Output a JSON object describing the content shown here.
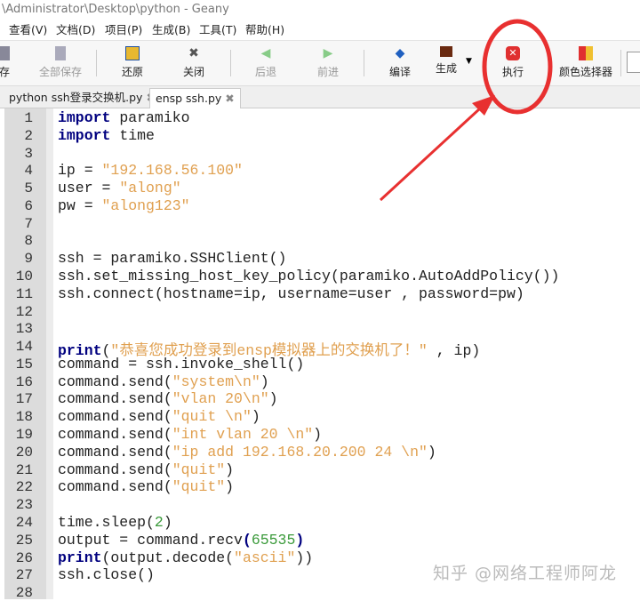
{
  "window": {
    "title": "\\Administrator\\Desktop\\python - Geany"
  },
  "menu": [
    "查看(V)",
    "文档(D)",
    "项目(P)",
    "生成(B)",
    "工具(T)",
    "帮助(H)"
  ],
  "toolbar": {
    "save": "存",
    "save_all": "全部保存",
    "revert": "还原",
    "close": "关闭",
    "back": "后退",
    "forward": "前进",
    "compile": "编译",
    "build": "生成",
    "execute": "执行",
    "color_picker": "颜色选择器"
  },
  "tabs": [
    {
      "label": "python ssh登录交换机.py",
      "close": "✖"
    },
    {
      "label": "ensp ssh.py",
      "close": "✖"
    }
  ],
  "code": [
    [
      [
        "k",
        "import"
      ],
      [
        "",
        " paramiko"
      ]
    ],
    [
      [
        "k",
        "import"
      ],
      [
        "",
        " time"
      ]
    ],
    [],
    [
      [
        "",
        "ip = "
      ],
      [
        "s",
        "\"192.168.56.100\""
      ]
    ],
    [
      [
        "",
        "user = "
      ],
      [
        "s",
        "\"along\""
      ]
    ],
    [
      [
        "",
        "pw = "
      ],
      [
        "s",
        "\"along123\""
      ]
    ],
    [],
    [],
    [
      [
        "",
        "ssh = paramiko.SSHClient()"
      ]
    ],
    [
      [
        "",
        "ssh.set_missing_host_key_policy(paramiko.AutoAddPolicy())"
      ]
    ],
    [
      [
        "",
        "ssh.connect(hostname=ip, username=user , password=pw)"
      ]
    ],
    [],
    [],
    [
      [
        "k",
        "print"
      ],
      [
        "",
        "("
      ],
      [
        "s",
        "\"恭喜您成功登录到ensp模拟器上的交换机了！\""
      ],
      [
        "",
        " , ip)"
      ]
    ],
    [
      [
        "",
        "command = ssh.invoke_shell()"
      ]
    ],
    [
      [
        "",
        "command.send("
      ],
      [
        "s",
        "\"system\\n\""
      ],
      [
        "",
        ")"
      ]
    ],
    [
      [
        "",
        "command.send("
      ],
      [
        "s",
        "\"vlan 20\\n\""
      ],
      [
        "",
        ")"
      ]
    ],
    [
      [
        "",
        "command.send("
      ],
      [
        "s",
        "\"quit \\n\""
      ],
      [
        "",
        ")"
      ]
    ],
    [
      [
        "",
        "command.send("
      ],
      [
        "s",
        "\"int vlan 20 \\n\""
      ],
      [
        "",
        ")"
      ]
    ],
    [
      [
        "",
        "command.send("
      ],
      [
        "s",
        "\"ip add 192.168.20.200 24 \\n\""
      ],
      [
        "",
        ")"
      ]
    ],
    [
      [
        "",
        "command.send("
      ],
      [
        "s",
        "\"quit\""
      ],
      [
        "",
        ")"
      ]
    ],
    [
      [
        "",
        "command.send("
      ],
      [
        "s",
        "\"quit\""
      ],
      [
        "",
        ")"
      ]
    ],
    [],
    [
      [
        "",
        "time.sleep("
      ],
      [
        "n",
        "2"
      ],
      [
        "",
        ")"
      ]
    ],
    [
      [
        "",
        "output = command.recv"
      ],
      [
        "p",
        "("
      ],
      [
        "n",
        "65535"
      ],
      [
        "p",
        ")"
      ]
    ],
    [
      [
        "k",
        "print"
      ],
      [
        "",
        "(output.decode("
      ],
      [
        "s",
        "\"ascii\""
      ],
      [
        "",
        "))"
      ]
    ],
    [
      [
        "",
        "ssh.close()"
      ]
    ],
    []
  ],
  "watermark": "知乎 @网络工程师阿龙"
}
